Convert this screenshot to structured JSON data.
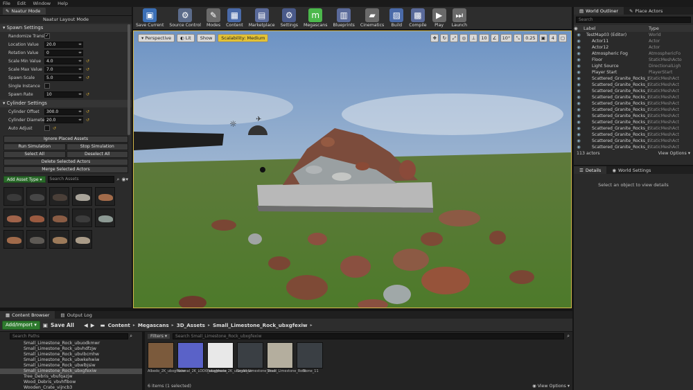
{
  "menu": [
    "File",
    "Edit",
    "Window",
    "Help"
  ],
  "mode_tab": "Naatur Mode",
  "left": {
    "panel_title": "Naatur Layout Mode",
    "spawn_settings": {
      "title": "Spawn Settings",
      "props": [
        {
          "label": "Randomize Transfor",
          "type": "check",
          "value": "✓"
        },
        {
          "label": "Location Value",
          "type": "num",
          "value": "20.0"
        },
        {
          "label": "Rotation Value",
          "type": "num",
          "value": "0"
        },
        {
          "label": "Scale Min Value",
          "type": "num",
          "value": "4.0",
          "reset": true
        },
        {
          "label": "Scale Max Value",
          "type": "num",
          "value": "7.0",
          "reset": true
        },
        {
          "label": "Spawn Scale",
          "type": "num",
          "value": "5.0",
          "reset": true
        },
        {
          "label": "Single Instance",
          "type": "check",
          "value": ""
        },
        {
          "label": "Spawn Rate",
          "type": "num",
          "value": "10",
          "reset": true
        }
      ]
    },
    "cylinder_settings": {
      "title": "Cylinder Settings",
      "props": [
        {
          "label": "Cylinder Offset",
          "type": "num",
          "value": "300.0",
          "reset": true
        },
        {
          "label": "Cylinder Diameter",
          "type": "num",
          "value": "20.0",
          "reset": true
        },
        {
          "label": "Auto Adjust",
          "type": "check",
          "value": "",
          "reset": true
        }
      ]
    },
    "buttons": {
      "ignore_placed": "Ignore Placed Assets",
      "run_sim": "Run Simulation",
      "stop_sim": "Stop Simulation",
      "select_all": "Select All",
      "deselect_all": "Deselect All",
      "delete_selected": "Delete Selected Actors",
      "merge_selected": "Merge Selected Actors"
    },
    "add_asset": "Add Asset Type ▾",
    "search_assets": "Search Assets"
  },
  "toolbar": [
    {
      "label": "Save Current",
      "icon": "save-icon",
      "color": "#3b6fb6",
      "glyph": "▣"
    },
    {
      "label": "Source Control",
      "icon": "source-control-icon",
      "color": "#5b6b8a",
      "glyph": "⚙"
    },
    {
      "label": "Modes",
      "icon": "modes-icon",
      "color": "#6a6a6a",
      "glyph": "✎"
    },
    {
      "label": "Content",
      "icon": "content-icon",
      "color": "#4a6aa8",
      "glyph": "▦"
    },
    {
      "label": "Marketplace",
      "icon": "marketplace-icon",
      "color": "#5a6a9a",
      "glyph": "▤"
    },
    {
      "label": "Settings",
      "icon": "settings-icon",
      "color": "#4a5a8a",
      "glyph": "⚙"
    },
    {
      "label": "Megascans",
      "icon": "megascans-icon",
      "color": "#4cb84c",
      "glyph": "m"
    },
    {
      "label": "Blueprints",
      "icon": "blueprints-icon",
      "color": "#5a6a9a",
      "glyph": "▥"
    },
    {
      "label": "Cinematics",
      "icon": "cinematics-icon",
      "color": "#6a6a6a",
      "glyph": "▰"
    },
    {
      "label": "Build",
      "icon": "build-icon",
      "color": "#4a6aa8",
      "glyph": "▨"
    },
    {
      "label": "Compile",
      "icon": "compile-icon",
      "color": "#5a6a9a",
      "glyph": "▩"
    },
    {
      "label": "Play",
      "icon": "play-icon",
      "color": "#6a6a6a",
      "glyph": "▶"
    },
    {
      "label": "Launch",
      "icon": "launch-icon",
      "color": "#6a6a6a",
      "glyph": "⏭"
    }
  ],
  "viewport": {
    "perspective": "Perspective",
    "lit": "Lit",
    "show": "Show",
    "scalability": "Scalability: Medium",
    "grid": "10",
    "angle": "10°",
    "scale": "0.25",
    "cam": "4"
  },
  "outliner": {
    "tab1": "World Outliner",
    "tab2": "Place Actors",
    "search": "Search",
    "col_label": "Label",
    "col_type": "Type",
    "rows": [
      {
        "name": "TestMap03 (Editor)",
        "type": "World",
        "indent": 0
      },
      {
        "name": "Actor11",
        "type": "Actor",
        "indent": 1
      },
      {
        "name": "Actor12",
        "type": "Actor",
        "indent": 1
      },
      {
        "name": "Atmospheric Fog",
        "type": "AtmosphericFo",
        "indent": 1
      },
      {
        "name": "Floor",
        "type": "StaticMeshActo",
        "indent": 1
      },
      {
        "name": "Light Source",
        "type": "DirectionalLigh",
        "indent": 1
      },
      {
        "name": "Player Start",
        "type": "PlayerStart",
        "indent": 1
      },
      {
        "name": "Scattered_Granite_Rocks_LC",
        "type": "StaticMeshAct",
        "indent": 1
      },
      {
        "name": "Scattered_Granite_Rocks_LC",
        "type": "StaticMeshAct",
        "indent": 1
      },
      {
        "name": "Scattered_Granite_Rocks_LC",
        "type": "StaticMeshAct",
        "indent": 1
      },
      {
        "name": "Scattered_Granite_Rocks_LC",
        "type": "StaticMeshAct",
        "indent": 1
      },
      {
        "name": "Scattered_Granite_Rocks_LC",
        "type": "StaticMeshAct",
        "indent": 1
      },
      {
        "name": "Scattered_Granite_Rocks_LC",
        "type": "StaticMeshAct",
        "indent": 1
      },
      {
        "name": "Scattered_Granite_Rocks_LC",
        "type": "StaticMeshAct",
        "indent": 1
      },
      {
        "name": "Scattered_Granite_Rocks_LC",
        "type": "StaticMeshAct",
        "indent": 1
      },
      {
        "name": "Scattered_Granite_Rocks_LC",
        "type": "StaticMeshAct",
        "indent": 1
      },
      {
        "name": "Scattered_Granite_Rocks_LC",
        "type": "StaticMeshAct",
        "indent": 1
      },
      {
        "name": "Scattered_Granite_Rocks_LC",
        "type": "StaticMeshAct",
        "indent": 1
      },
      {
        "name": "Scattered_Granite_Rocks_LC",
        "type": "StaticMeshAct",
        "indent": 1
      }
    ],
    "count": "113 actors",
    "view_options": "View Options ▾"
  },
  "details": {
    "tab1": "Details",
    "tab2": "World Settings",
    "empty": "Select an object to view details"
  },
  "content_browser": {
    "tab1": "Content Browser",
    "tab2": "Output Log",
    "add_import": "Add/Import ▾",
    "save_all": "Save All",
    "crumbs": [
      "Content",
      "Megascans",
      "3D_Assets",
      "Small_Limestone_Rock_ubxgfexiw"
    ],
    "search_paths": "Search Paths",
    "filters": "Filters ▾",
    "search_asset": "Search Small_Limestone_Rock_ubxgfexiw",
    "folders": [
      "Small_Limestone_Rock_ubuodkmwr",
      "Small_Limestone_Rock_ubvhdfzjw",
      "Small_Limestone_Rock_ubvibcmhw",
      "Small_Limestone_Rock_ubwkehwiw",
      "Small_Limestone_Rock_ubwlbjsiw",
      "Small_Limestone_Rock_ubxgfexiw",
      "Tree_Debris_vbufqazjw",
      "Wood_Debris_vbvhflbow",
      "Wooden_Crate_vijncb3"
    ],
    "selected_folder": 5,
    "assets": [
      {
        "label": "Albedo_2K_ubxgfexiw",
        "color": "#7b5a3c"
      },
      {
        "label": "Normal_2K_LOD0_ubxgfexiw",
        "color": "#5a62c8"
      },
      {
        "label": "Roughness_2K_ubxgfexiw",
        "color": "#e8e8e8"
      },
      {
        "label": "Small_Limestone_Rock",
        "color": "#3a3f44"
      },
      {
        "label": "Small_Limestone_Rock",
        "color": "#b4ae9e"
      },
      {
        "label": "Stone_11",
        "color": "#3a3f44"
      }
    ],
    "status": "6 items (1 selected)",
    "view_options": "View Options ▾"
  }
}
